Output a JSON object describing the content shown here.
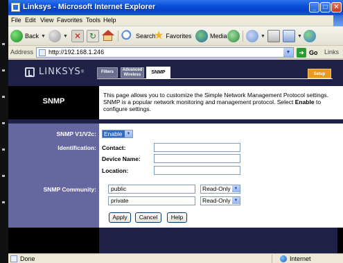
{
  "window": {
    "title": "Linksys - Microsoft Internet Explorer",
    "minimize": "_",
    "maximize": "□",
    "close": "✕"
  },
  "menu": [
    "File",
    "Edit",
    "View",
    "Favorites",
    "Tools",
    "Help"
  ],
  "toolbar": {
    "back": "Back",
    "search": "Search",
    "favorites": "Favorites",
    "media": "Media"
  },
  "address": {
    "label": "Address",
    "url": "http://192.168.1.246",
    "go": "Go",
    "links": "Links"
  },
  "router": {
    "brand": "LINKSYS",
    "reg": "®",
    "tabs": {
      "filters": "Filters",
      "advanced_line1": "Advanced",
      "advanced_line2": "Wireless",
      "snmp": "SNMP"
    },
    "setup": "Setup",
    "section_title": "SNMP",
    "intro_part1": "This page allows you to customize the Simple Network Management Protocol settings. SNMP is a popular network monitoring and management protocol. Select ",
    "intro_bold": "Enable",
    "intro_part2": " to configure settings.",
    "labels": {
      "snmp_version": "SNMP V1/V2c:",
      "identification": "Identification:",
      "community": "SNMP Community:"
    },
    "snmp_version_value": "Enable",
    "fields": {
      "contact": "Contact:",
      "device_name": "Device Name:",
      "location": "Location:"
    },
    "communities": [
      {
        "name": "public",
        "access": "Read-Only"
      },
      {
        "name": "private",
        "access": "Read-Only"
      }
    ],
    "buttons": {
      "apply": "Apply",
      "cancel": "Cancel",
      "help": "Help"
    }
  },
  "status": {
    "text": "Done",
    "zone": "Internet"
  }
}
